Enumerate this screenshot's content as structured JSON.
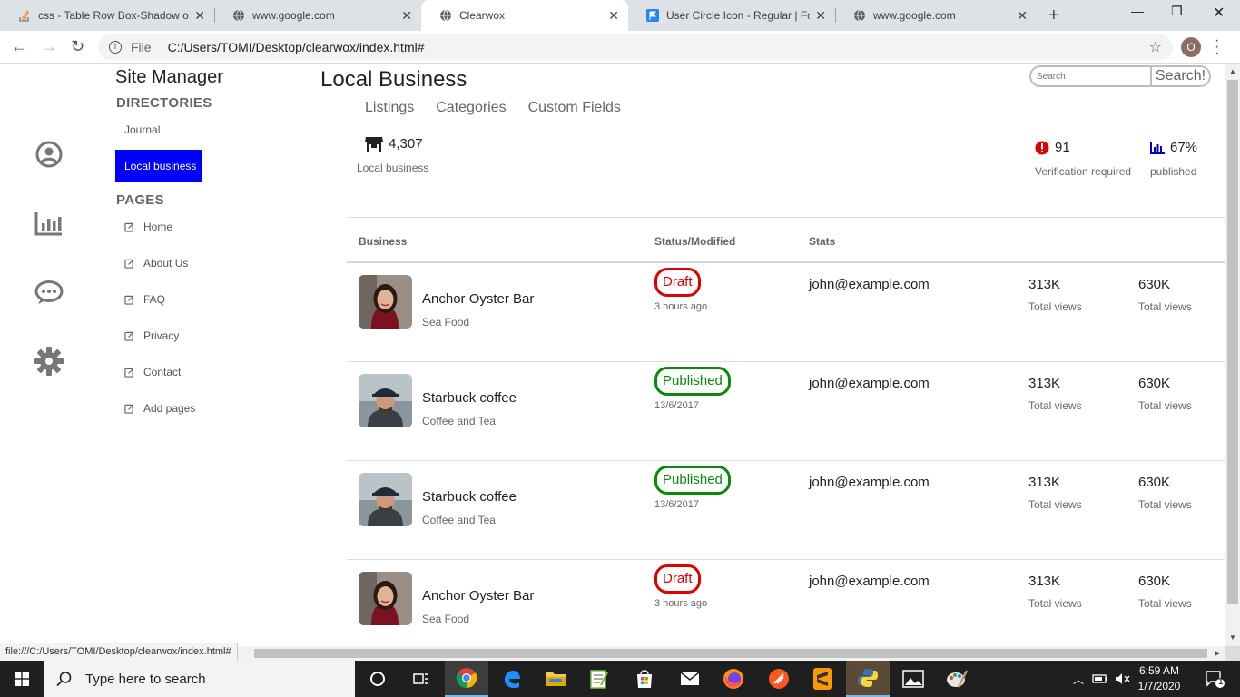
{
  "browser": {
    "tabs": [
      {
        "title": "css - Table Row Box-Shadow o",
        "icon": "stackoverflow-icon"
      },
      {
        "title": "www.google.com",
        "icon": "globe-icon"
      },
      {
        "title": "Clearwox",
        "icon": "globe-icon",
        "active": true
      },
      {
        "title": "User Circle Icon - Regular | Font",
        "icon": "fontawesome-flag-icon"
      },
      {
        "title": "www.google.com",
        "icon": "globe-icon"
      }
    ],
    "address": {
      "label": "File",
      "url": "C:/Users/TOMI/Desktop/clearwox/index.html#"
    },
    "profile_initial": "O",
    "status_url": "file:///C:/Users/TOMI/Desktop/clearwox/index.html#"
  },
  "rail_icons": [
    "user-circle-icon",
    "chart-bar-icon",
    "comment-dots-icon",
    "cog-icon"
  ],
  "sidebar": {
    "title": "Site Manager",
    "directories_heading": "DIRECTORIES",
    "directories": [
      {
        "label": "Journal",
        "active": false
      },
      {
        "label": "Local business",
        "active": true
      }
    ],
    "pages_heading": "PAGES",
    "pages": [
      "Home",
      "About Us",
      "FAQ",
      "Privacy",
      "Contact",
      "Add pages"
    ]
  },
  "main": {
    "title": "Local Business",
    "tabs": [
      "Listings",
      "Categories",
      "Custom Fields"
    ],
    "search": {
      "placeholder": "Search",
      "button": "Search!"
    },
    "summary": {
      "count": {
        "value": "4,307",
        "label": "Local business",
        "icon": "store-icon"
      },
      "verification": {
        "value": "91",
        "label": "Verification required",
        "icon": "exclamation-circle-icon"
      },
      "published": {
        "value": "67%",
        "label": "published",
        "icon": "chart-bar-icon"
      }
    },
    "columns": [
      "Business",
      "Status/Modified",
      "Stats"
    ],
    "rows": [
      {
        "name": "Anchor Oyster Bar",
        "category": "Sea Food",
        "status": "Draft",
        "modified": "3 hours ago",
        "owner": "john@example.com",
        "views1": "313K",
        "views1_label": "Total views",
        "views2": "630K",
        "views2_label": "Total views",
        "avatar": "woman"
      },
      {
        "name": "Starbuck coffee",
        "category": "Coffee and Tea",
        "status": "Published",
        "modified": "13/6/2017",
        "owner": "john@example.com",
        "views1": "313K",
        "views1_label": "Total views",
        "views2": "630K",
        "views2_label": "Total views",
        "avatar": "man"
      },
      {
        "name": "Starbuck coffee",
        "category": "Coffee and Tea",
        "status": "Published",
        "modified": "13/6/2017",
        "owner": "john@example.com",
        "views1": "313K",
        "views1_label": "Total views",
        "views2": "630K",
        "views2_label": "Total views",
        "avatar": "man"
      },
      {
        "name": "Anchor Oyster Bar",
        "category": "Sea Food",
        "status": "Draft",
        "modified": "3 hours ago",
        "owner": "john@example.com",
        "views1": "313K",
        "views1_label": "Total views",
        "views2": "630K",
        "views2_label": "Total views",
        "avatar": "woman"
      }
    ],
    "colors": {
      "active_nav": "#0000ff",
      "draft": "#dd0000",
      "published": "#0a8a0a",
      "alert": "#dd0000",
      "chart_icon": "#0000cc"
    }
  },
  "taskbar": {
    "search_placeholder": "Type here to search",
    "time": "6:59 AM",
    "date": "1/7/2020",
    "notification_count": "1",
    "apps": [
      "cortana-icon",
      "task-view-icon",
      "chrome-icon",
      "edge-icon",
      "file-explorer-icon",
      "notepad-plus-icon",
      "store-icon",
      "mail-icon",
      "firefox-icon",
      "brave-icon",
      "sublime-icon",
      "python-icon",
      "photos-icon",
      "paint-icon"
    ]
  }
}
